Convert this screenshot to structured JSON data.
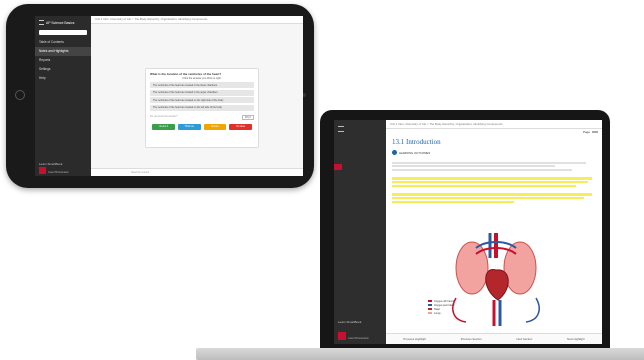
{
  "tablet": {
    "sidebar_title": "AP Science Basics",
    "sidebar_items": [
      "Table of Contents",
      "Notes and Highlights",
      "Reports",
      "Settings",
      "Help"
    ],
    "sidebar_bottom": "Learn SmartBook",
    "logo_text": "Graw Hill Education",
    "topbar": "Unit 1 Intro: Chemistry of Life > The Body Hierarchy; Organization; Identifying Components",
    "question": "What is the location of the ventricles of the heart?",
    "hint": "Click the answer you think is right.",
    "options": [
      "The ventricles of the heart are located in the lower chambers",
      "The ventricles of the heart are located in the upper chambers",
      "The ventricles of the heart are located on the right side of the body",
      "The ventricles of the heart are located on the left side of the body"
    ],
    "ask_text": "Do you know the answer?",
    "why_label": "Why?",
    "buttons": [
      {
        "label": "I know it",
        "color": "#3aa047"
      },
      {
        "label": "Think so",
        "color": "#2e9bd6"
      },
      {
        "label": "Unsure",
        "color": "#f0a500"
      },
      {
        "label": "No idea",
        "color": "#e0302a"
      }
    ],
    "bottombar": "Read the content"
  },
  "laptop": {
    "topbar": "Unit 1 Intro: Chemistry of Life > The Body Hierarchy; Organization; Identifying Components",
    "page_label": "Page",
    "page_value": "",
    "heading": "13.1 Introduction",
    "audio_label": "LEARNING OUTCOMES",
    "bottombar": [
      "Previous Highlight",
      "Previous Section",
      "Next Section",
      "Next Highlight"
    ],
    "legend": [
      "Oxygen-rich blood",
      "Oxygen-poor blood",
      "Heart",
      "Lungs"
    ],
    "sidebar_bottom": "Learn SmartBook",
    "logo_text": "Graw Hill Education"
  }
}
